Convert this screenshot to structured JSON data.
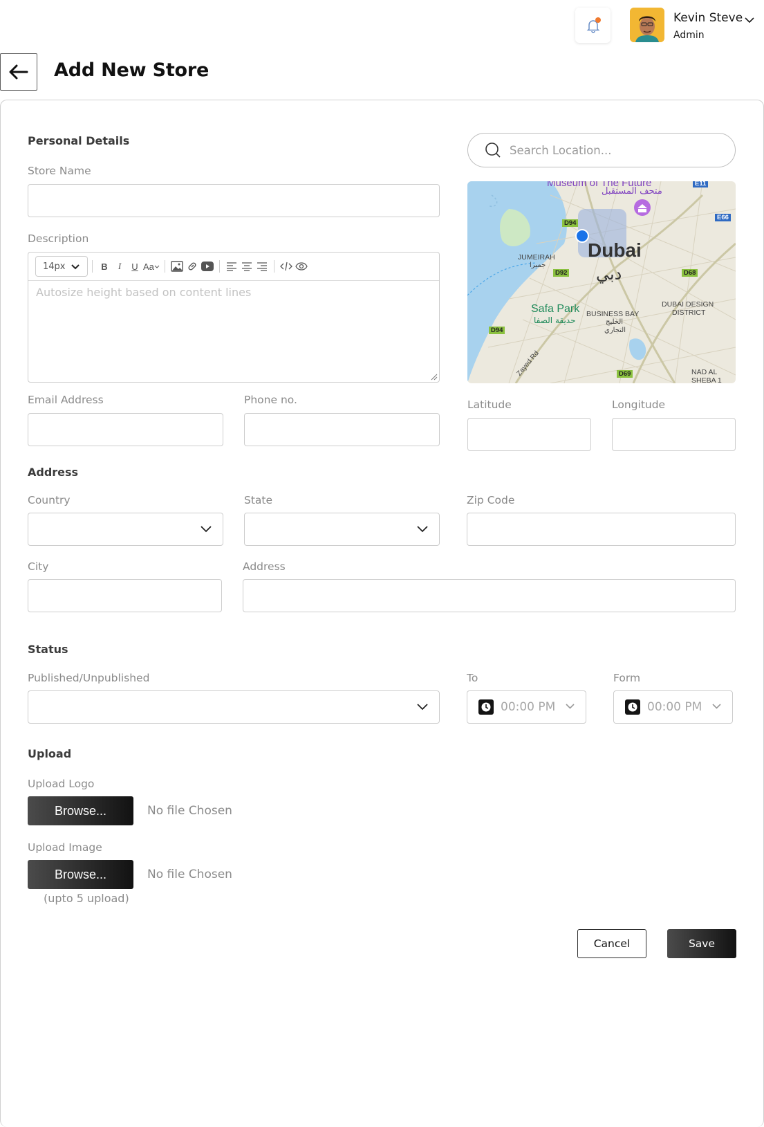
{
  "header": {
    "user_name": "Kevin Steve",
    "user_role": "Admin"
  },
  "page": {
    "title": "Add New Store"
  },
  "personal": {
    "section": "Personal Details",
    "store_name_label": "Store Name",
    "description_label": "Description",
    "font_size": "14px",
    "text_case_label": "Aa",
    "description_placeholder": "Autosize height based on content lines",
    "email_label": "Email Address",
    "phone_label": "Phone no."
  },
  "map": {
    "search_placeholder": "Search Location...",
    "latitude_label": "Latitude",
    "longitude_label": "Longitude",
    "labels": {
      "museum_en": "Museum of The Future",
      "museum_ar": "متحف المستقبل",
      "city_en": "Dubai",
      "city_ar": "دبي",
      "jumeirah_en": "JUMEIRAH",
      "jumeirah_ar": "جميرا",
      "safa_en": "Safa Park",
      "safa_ar": "حديقة الصفا",
      "business_bay_en": "BUSINESS BAY",
      "business_bay_ar1": "الخليج",
      "business_bay_ar2": "التجاري",
      "design_district_1": "DUBAI DESIGN",
      "design_district_2": "DISTRICT",
      "zayed_rd": "Zayed Rd",
      "nad_al_sheba_1": "NAD AL",
      "nad_al_sheba_2": "SHEBA 1",
      "road_d94_a": "D94",
      "road_d94_b": "D94",
      "road_d92": "D92",
      "road_d68": "D68",
      "road_d69": "D69",
      "road_e11": "E11",
      "road_e66": "E66"
    }
  },
  "address": {
    "section": "Address",
    "country_label": "Country",
    "state_label": "State",
    "zip_label": "Zip Code",
    "city_label": "City",
    "address_label": "Address"
  },
  "status": {
    "section": "Status",
    "published_label": "Published/Unpublished",
    "to_label": "To",
    "form_label": "Form",
    "to_time": "00:00 PM",
    "form_time": "00:00 PM"
  },
  "upload": {
    "section": "Upload",
    "logo_label": "Upload Logo",
    "image_label": "Upload Image",
    "browse_label": "Browse...",
    "no_file": "No file Chosen",
    "upload_hint": "(upto 5 upload)"
  },
  "actions": {
    "cancel": "Cancel",
    "save": "Save"
  },
  "colors": {
    "accent_dark": "#141414",
    "notification_dot": "#f07a2f",
    "map_pin": "#1a73e8"
  }
}
